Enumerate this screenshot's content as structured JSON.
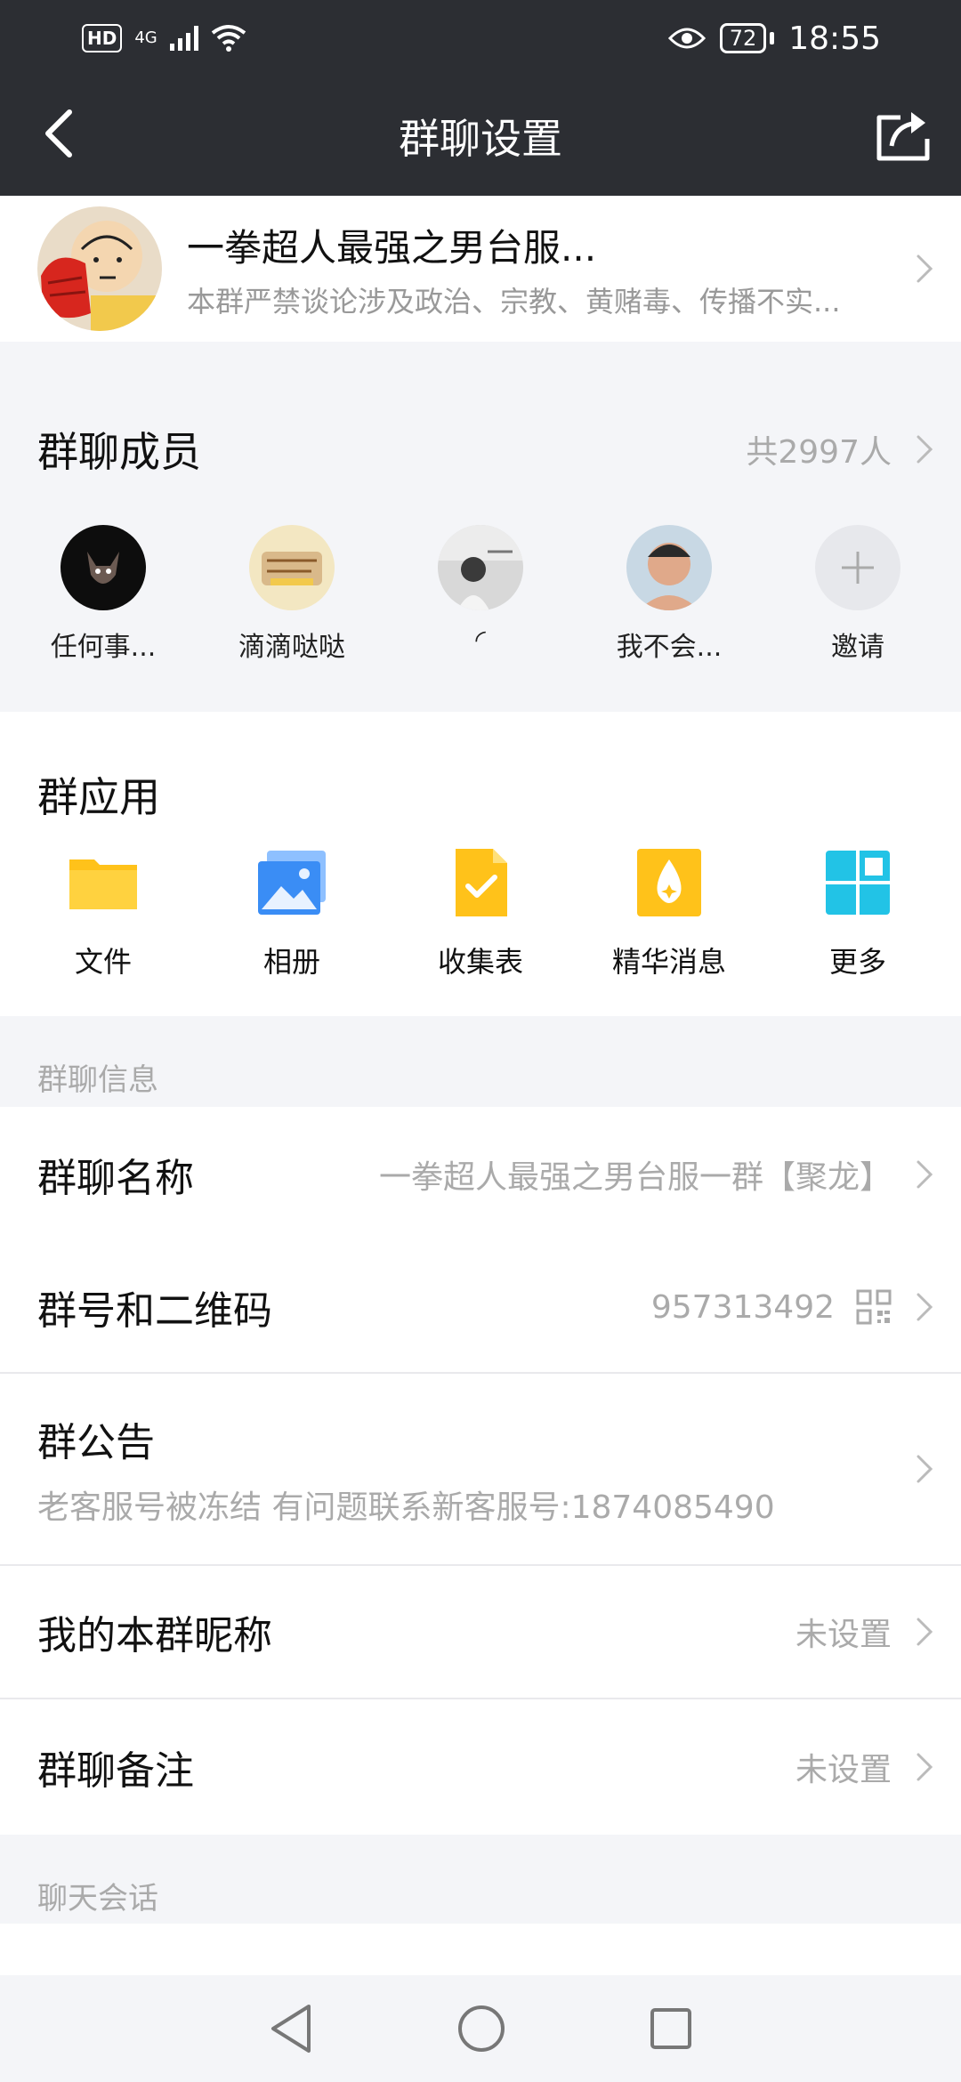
{
  "status_bar": {
    "hd": "HD",
    "network": "4G",
    "battery": "72",
    "time": "18:55"
  },
  "nav": {
    "title": "群聊设置"
  },
  "group": {
    "name": "一拳超人最强之男台服...",
    "description": "本群严禁谈论涉及政治、宗教、黄赌毒、传播不实..."
  },
  "members": {
    "title": "群聊成员",
    "count": "共2997人",
    "list": [
      {
        "name": "任何事..."
      },
      {
        "name": "滴滴哒哒"
      },
      {
        "name": "◜"
      },
      {
        "name": "我不会..."
      }
    ],
    "invite_label": "邀请"
  },
  "apps": {
    "title": "群应用",
    "items": [
      {
        "label": "文件",
        "icon": "folder-icon"
      },
      {
        "label": "相册",
        "icon": "album-icon"
      },
      {
        "label": "收集表",
        "icon": "form-icon"
      },
      {
        "label": "精华消息",
        "icon": "essence-icon"
      },
      {
        "label": "更多",
        "icon": "grid-more-icon"
      }
    ]
  },
  "group_info": {
    "section_label": "群聊信息",
    "name_row": {
      "title": "群聊名称",
      "value": "一拳超人最强之男台服一群【聚龙】"
    },
    "number_row": {
      "title": "群号和二维码",
      "value": "957313492"
    },
    "announce_row": {
      "title": "群公告",
      "value": "老客服号被冻结 有问题联系新客服号:1874085490"
    },
    "nickname_row": {
      "title": "我的本群昵称",
      "value": "未设置"
    },
    "remark_row": {
      "title": "群聊备注",
      "value": "未设置"
    }
  },
  "chat_session": {
    "section_label": "聊天会话"
  },
  "colors": {
    "header_bg": "#2c2e33",
    "page_bg": "#f4f5f8",
    "muted_text": "#aaaaaa",
    "folder_yellow": "#ffc21a",
    "album_blue": "#3a8df5",
    "more_cyan": "#22c3e6"
  }
}
